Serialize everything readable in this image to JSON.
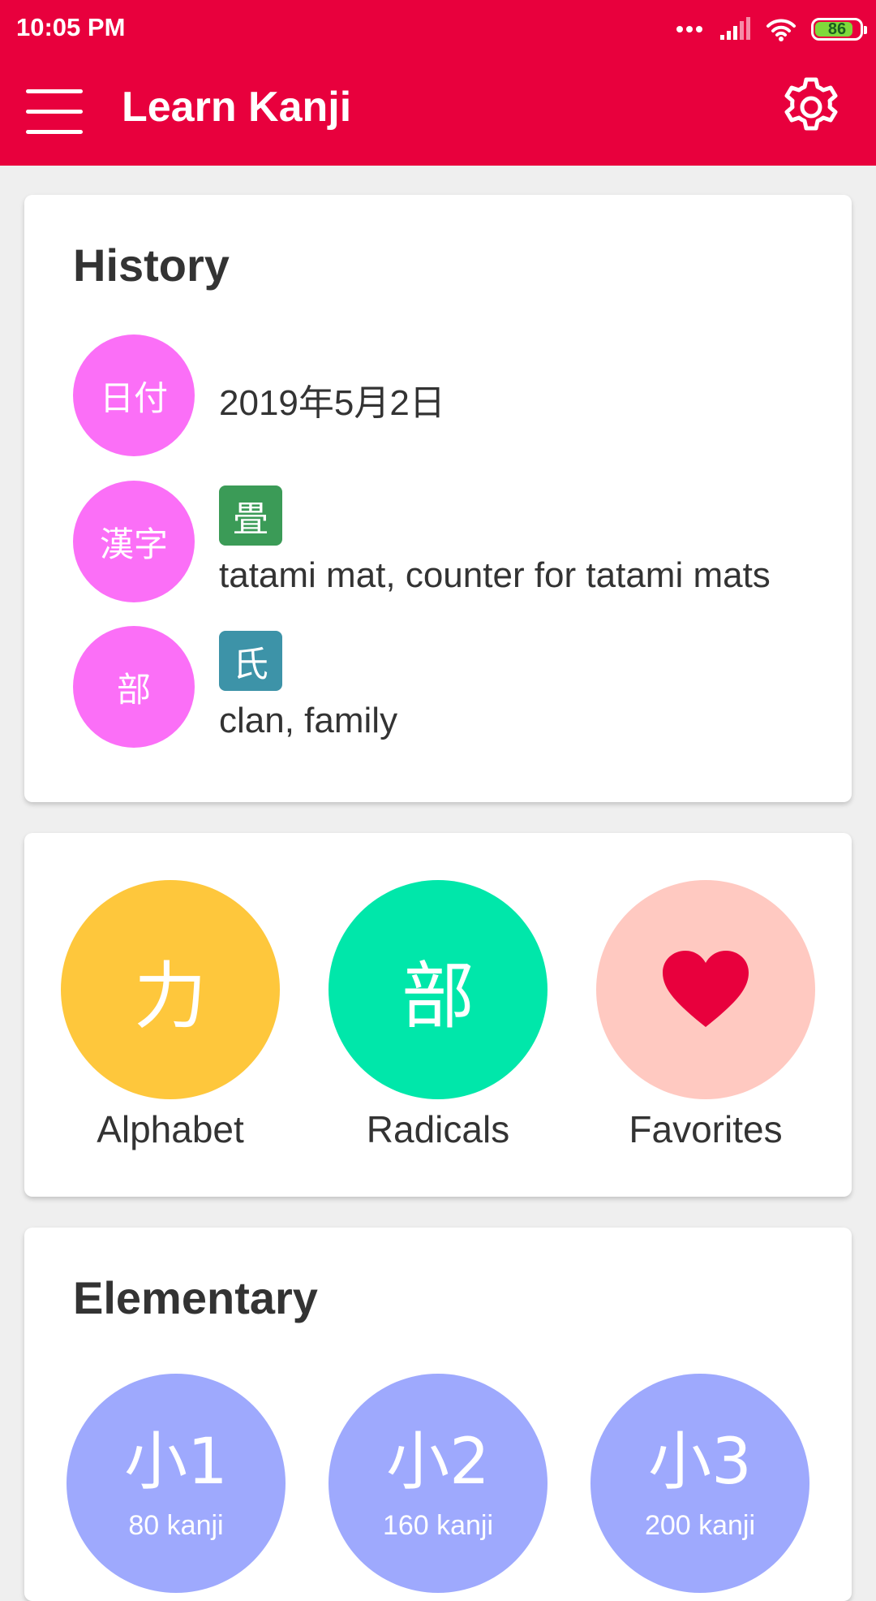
{
  "status_bar": {
    "time": "10:05 PM",
    "battery": "86",
    "battery_level": 0.86
  },
  "app_bar": {
    "title": "Learn Kanji",
    "menu_icon": "hamburger-menu-icon",
    "settings_icon": "gear-icon"
  },
  "history": {
    "title": "History",
    "items": [
      {
        "circle": "日付",
        "text": "2019年5月2日"
      },
      {
        "circle": "漢字",
        "badge": "畳",
        "badge_color": "#3b9b57",
        "text": "tatami mat, counter for tatami mats"
      },
      {
        "circle": "部",
        "badge": "氏",
        "badge_color": "#3d93a8",
        "text": "clan, family"
      }
    ]
  },
  "shortcuts": [
    {
      "symbol": "力",
      "label": "Alphabet",
      "color": "#fec73c"
    },
    {
      "symbol": "部",
      "label": "Radicals",
      "color": "#00e7aa"
    },
    {
      "symbol": "heart-icon",
      "label": "Favorites",
      "color": "#ffc9c1"
    }
  ],
  "elementary": {
    "title": "Elementary",
    "grades": [
      {
        "label": "小1",
        "count": "80 kanji"
      },
      {
        "label": "小2",
        "count": "160 kanji"
      },
      {
        "label": "小3",
        "count": "200 kanji"
      }
    ]
  },
  "colors": {
    "primary": "#e8003d",
    "history_circle": "#fb6ff7",
    "grade_circle": "#9ea9fd"
  }
}
